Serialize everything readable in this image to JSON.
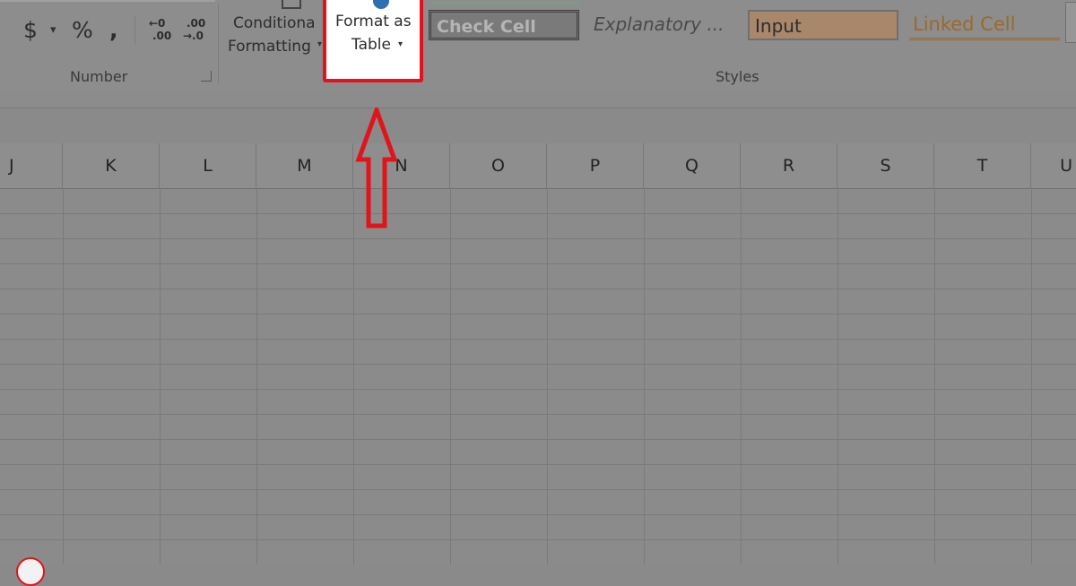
{
  "ribbon": {
    "number_group": {
      "label": "Number",
      "currency_symbol": "$",
      "currency_dropdown": "▾",
      "percent_symbol": "%",
      "comma_symbol": ",",
      "increase_decimal": {
        "top": "←0",
        "bottom": ".00"
      },
      "decrease_decimal": {
        "top": ".00",
        "bottom": "→.0"
      }
    },
    "conditional_formatting": {
      "line1": "Conditiona",
      "line2": "Formatting"
    },
    "format_as_table": {
      "line1": "Format as",
      "line2": "Table",
      "dropdown": "▾"
    },
    "styles": {
      "label": "Styles",
      "cells": [
        "Check Cell",
        "Explanatory ...",
        "Input",
        "Linked Cell"
      ]
    }
  },
  "sheet": {
    "columns": [
      "J",
      "K",
      "L",
      "M",
      "N",
      "O",
      "P",
      "Q",
      "R",
      "S",
      "T",
      "U"
    ]
  },
  "colors": {
    "highlight": "#e0141b",
    "overlay": "#8a8a8a",
    "input_fill": "#a8876b",
    "linked_text": "#9a6a2a"
  }
}
